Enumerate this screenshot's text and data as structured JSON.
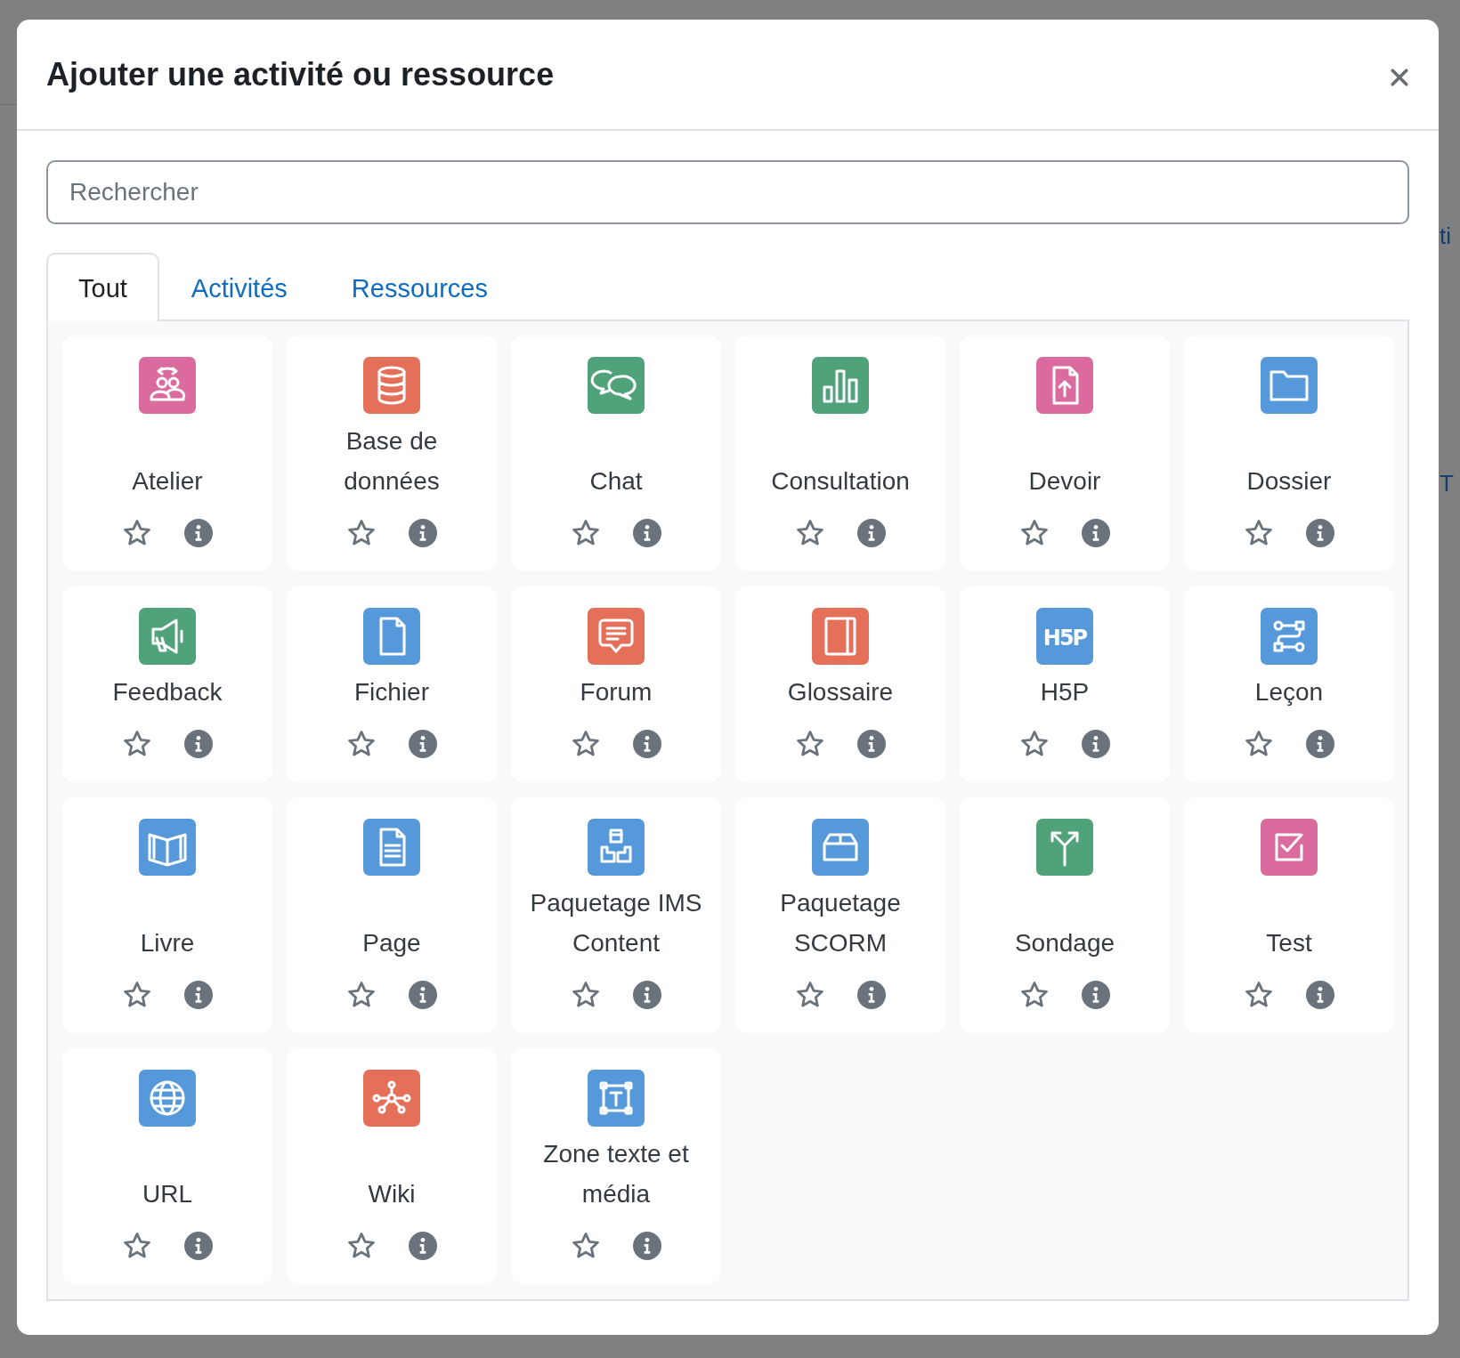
{
  "background": {
    "right_texts": [
      "ti",
      "T"
    ]
  },
  "dialog": {
    "title": "Ajouter une activité ou ressource"
  },
  "search": {
    "placeholder": "Rechercher"
  },
  "tabs": [
    {
      "label": "Tout",
      "selected": true
    },
    {
      "label": "Activités",
      "selected": false
    },
    {
      "label": "Ressources",
      "selected": false
    }
  ],
  "items": [
    {
      "name": "Atelier",
      "color": "#db6b9f",
      "starred": false
    },
    {
      "name": "Base de données",
      "color": "#e5705a",
      "starred": false
    },
    {
      "name": "Chat",
      "color": "#50a27a",
      "starred": false
    },
    {
      "name": "Consultation",
      "color": "#50a27a",
      "starred": false
    },
    {
      "name": "Devoir",
      "color": "#db6b9f",
      "starred": false
    },
    {
      "name": "Dossier",
      "color": "#5599db",
      "starred": false
    },
    {
      "name": "Feedback",
      "color": "#50a27a",
      "starred": false
    },
    {
      "name": "Fichier",
      "color": "#5599db",
      "starred": false
    },
    {
      "name": "Forum",
      "color": "#e5705a",
      "starred": false
    },
    {
      "name": "Glossaire",
      "color": "#e5705a",
      "starred": false
    },
    {
      "name": "H5P",
      "color": "#5599db",
      "starred": false,
      "icon_text": "H5P"
    },
    {
      "name": "Leçon",
      "color": "#5599db",
      "starred": false
    },
    {
      "name": "Livre",
      "color": "#5599db",
      "starred": false
    },
    {
      "name": "Page",
      "color": "#5599db",
      "starred": false
    },
    {
      "name": "Paquetage IMS Content",
      "color": "#5599db",
      "starred": false
    },
    {
      "name": "Paquetage SCORM",
      "color": "#5599db",
      "starred": false
    },
    {
      "name": "Sondage",
      "color": "#50a27a",
      "starred": false
    },
    {
      "name": "Test",
      "color": "#db6b9f",
      "starred": false
    },
    {
      "name": "URL",
      "color": "#5599db",
      "starred": false
    },
    {
      "name": "Wiki",
      "color": "#e5705a",
      "starred": false
    },
    {
      "name": "Zone texte et média",
      "color": "#5599db",
      "starred": false
    }
  ]
}
